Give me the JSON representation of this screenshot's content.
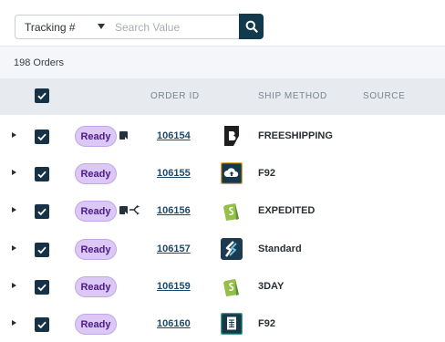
{
  "filter": {
    "field_selected": "Tracking #",
    "search_placeholder": "Search Value",
    "search_value": ""
  },
  "summary": {
    "order_count": "198 Orders"
  },
  "columns": {
    "order_id": "ORDER ID",
    "ship_method": "SHIP METHOD",
    "source": "SOURCE"
  },
  "rows": [
    {
      "status": "Ready",
      "order_id": "106154",
      "ship_method": "FREESHIPPING",
      "source_icon": "bigcommerce-icon",
      "note": true,
      "split": false
    },
    {
      "status": "Ready",
      "order_id": "106155",
      "ship_method": "F92",
      "source_icon": "cloud-upload-icon",
      "note": false,
      "split": false
    },
    {
      "status": "Ready",
      "order_id": "106156",
      "ship_method": "EXPEDITED",
      "source_icon": "shopify-icon",
      "note": true,
      "split": true
    },
    {
      "status": "Ready",
      "order_id": "106157",
      "ship_method": "Standard",
      "source_icon": "shipstation-icon",
      "note": false,
      "split": false
    },
    {
      "status": "Ready",
      "order_id": "106159",
      "ship_method": "3DAY",
      "source_icon": "shopify-icon",
      "note": false,
      "split": false
    },
    {
      "status": "Ready",
      "order_id": "106160",
      "ship_method": "F92",
      "source_icon": "csv-file-icon",
      "note": false,
      "split": false
    }
  ],
  "colors": {
    "accent_dark": "#123a4c",
    "status_ready_bg": "#dcc8f5",
    "status_ready_text": "#4b1a86",
    "link": "#1d4a6a"
  }
}
